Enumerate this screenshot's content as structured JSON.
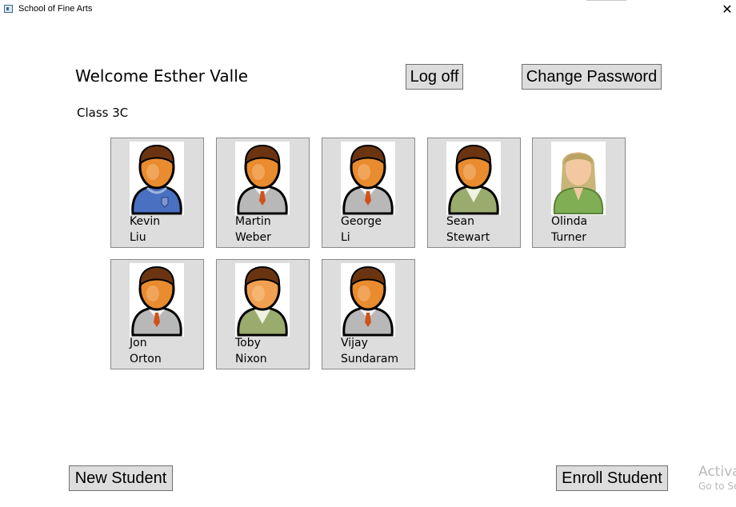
{
  "window": {
    "title": "School of Fine Arts",
    "close_glyph": "✕"
  },
  "header": {
    "welcome": "Welcome Esther Valle",
    "logoff_label": "Log off",
    "change_password_label": "Change Password"
  },
  "class_label": "Class 3C",
  "students": [
    {
      "first": "Kevin",
      "last": "Liu",
      "avatar": "boy-blue-sweater-icon"
    },
    {
      "first": "Martin",
      "last": "Weber",
      "avatar": "boy-grey-suit-icon"
    },
    {
      "first": "George",
      "last": "Li",
      "avatar": "boy-grey-suit-icon"
    },
    {
      "first": "Sean",
      "last": "Stewart",
      "avatar": "boy-green-jacket-icon"
    },
    {
      "first": "Olinda",
      "last": "Turner",
      "avatar": "girl-green-top-icon"
    },
    {
      "first": "Jon",
      "last": "Orton",
      "avatar": "boy-grey-suit-icon"
    },
    {
      "first": "Toby",
      "last": "Nixon",
      "avatar": "boy-green-jacket-icon"
    },
    {
      "first": "Vijay",
      "last": "Sundaram",
      "avatar": "boy-grey-suit-icon"
    }
  ],
  "footer": {
    "new_student_label": "New Student",
    "enroll_student_label": "Enroll Student"
  },
  "watermark": {
    "line1": "Activate Windows",
    "line2": "Go to Settings to activate Windows."
  },
  "colors": {
    "card_bg": "#dddddd",
    "skin": "#e98b2f",
    "hair": "#6b3410",
    "blue_sweater": "#4a70c2",
    "grey_suit": "#b8b8b8",
    "green_jacket": "#9aab6e",
    "girl_top": "#7fae55",
    "girl_hair": "#c9b57a"
  }
}
